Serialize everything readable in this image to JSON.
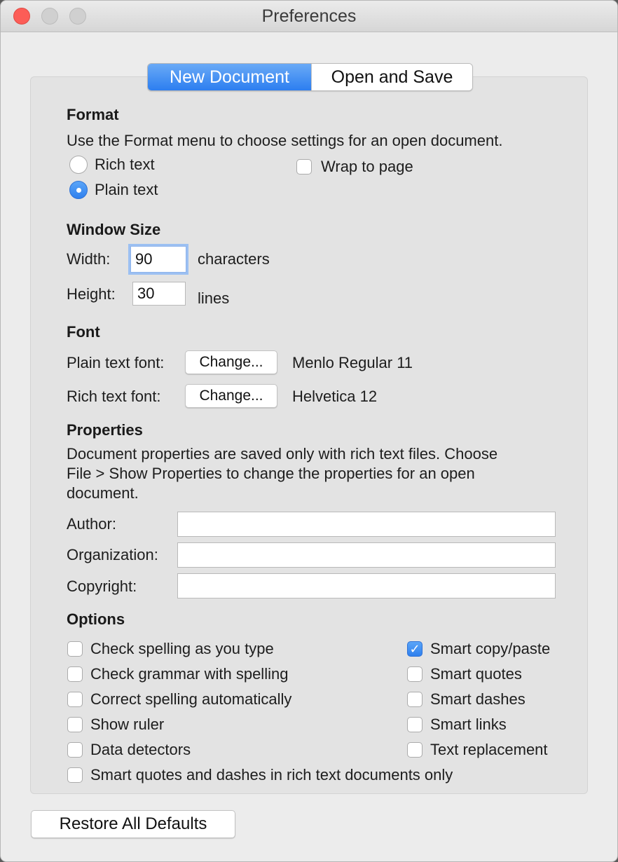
{
  "window": {
    "title": "Preferences"
  },
  "tabs": {
    "new_document": "New Document",
    "open_and_save": "Open and Save"
  },
  "format": {
    "heading": "Format",
    "description": "Use the Format menu to choose settings for an open document.",
    "rich_text_label": "Rich text",
    "plain_text_label": "Plain text",
    "selected": "Plain text",
    "wrap_to_page_label": "Wrap to page",
    "wrap_to_page_checked": false
  },
  "window_size": {
    "heading": "Window Size",
    "width_label": "Width:",
    "width_value": "90",
    "width_unit": "characters",
    "height_label": "Height:",
    "height_value": "30",
    "height_unit": "lines"
  },
  "font": {
    "heading": "Font",
    "plain_label": "Plain text font:",
    "plain_button": "Change...",
    "plain_value": "Menlo Regular 11",
    "rich_label": "Rich text font:",
    "rich_button": "Change...",
    "rich_value": "Helvetica 12"
  },
  "properties": {
    "heading": "Properties",
    "desc_line1": "Document properties are saved only with rich text files. Choose",
    "desc_line2": "File > Show Properties to change the properties for an open",
    "desc_line3": "document.",
    "author_label": "Author:",
    "author_value": "",
    "organization_label": "Organization:",
    "organization_value": "",
    "copyright_label": "Copyright:",
    "copyright_value": ""
  },
  "options": {
    "heading": "Options",
    "check_spelling": "Check spelling as you type",
    "check_grammar": "Check grammar with spelling",
    "correct_spelling": "Correct spelling automatically",
    "show_ruler": "Show ruler",
    "data_detectors": "Data detectors",
    "smart_rich_only": "Smart quotes and dashes in rich text documents only",
    "smart_copy_paste": "Smart copy/paste",
    "smart_quotes": "Smart quotes",
    "smart_dashes": "Smart dashes",
    "smart_links": "Smart links",
    "text_replacement": "Text replacement",
    "checked": [
      "Smart copy/paste"
    ]
  },
  "footer": {
    "restore_defaults": "Restore All Defaults"
  },
  "colors": {
    "accent": "#2f80ee",
    "close_button": "#fc5d57",
    "window_bg": "#ececec"
  }
}
